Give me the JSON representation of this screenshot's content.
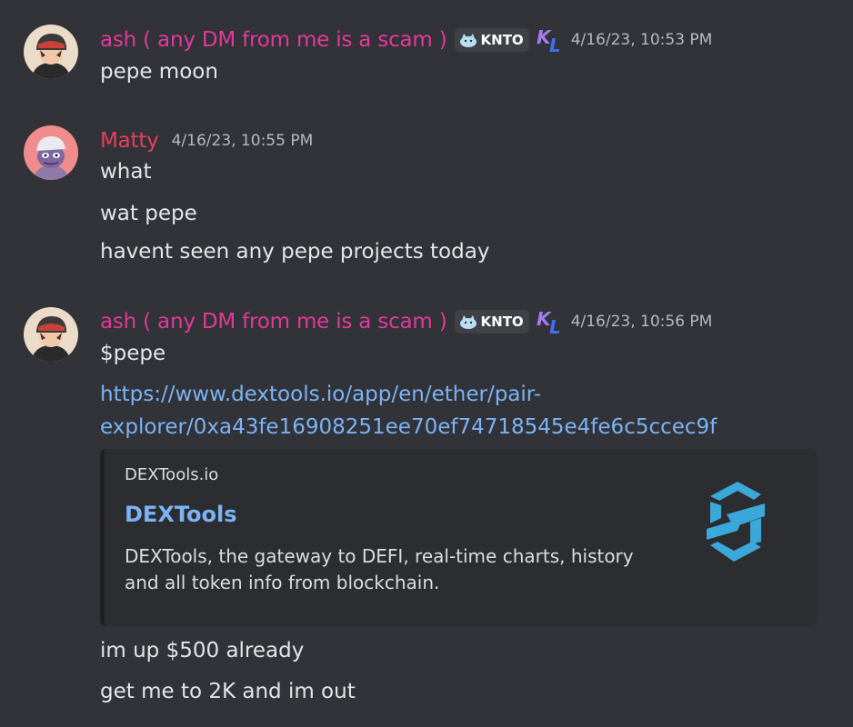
{
  "messages": [
    {
      "author": "ash ( any DM from me is a scam )",
      "author_color": "#e3399a",
      "tag": "KNTO",
      "timestamp": "4/16/23, 10:53 PM",
      "lines": [
        "pepe moon"
      ]
    },
    {
      "author": "Matty",
      "author_color": "#e5405b",
      "timestamp": "4/16/23, 10:55 PM",
      "lines": [
        "what",
        "wat pepe",
        "havent seen any pepe projects today"
      ]
    },
    {
      "author": "ash ( any DM from me is a scam )",
      "author_color": "#e3399a",
      "tag": "KNTO",
      "timestamp": "4/16/23, 10:56 PM",
      "lines": [
        "$pepe"
      ],
      "link_lines": [
        "https://www.dextools.io/app/en/ether/pair-",
        "explorer/0xa43fe16908251ee70ef74718545e4fe6c5ccec9f"
      ],
      "embed": {
        "provider": "DEXTools.io",
        "title": "DEXTools",
        "description": "DEXTools, the gateway to DEFI, real-time charts, history and all token info from blockchain."
      },
      "after_lines": [
        "im up $500 already",
        "get me to 2K and im out"
      ]
    }
  ],
  "icons": {
    "tag_icon": "cat-icon",
    "role_icon": "kl-badge-icon",
    "embed_thumbnail": "dextools-logo"
  },
  "colors": {
    "background": "#313338",
    "link": "#7cb3f5",
    "timestamp": "#b5bac1",
    "embed_background": "#2b2d31"
  }
}
